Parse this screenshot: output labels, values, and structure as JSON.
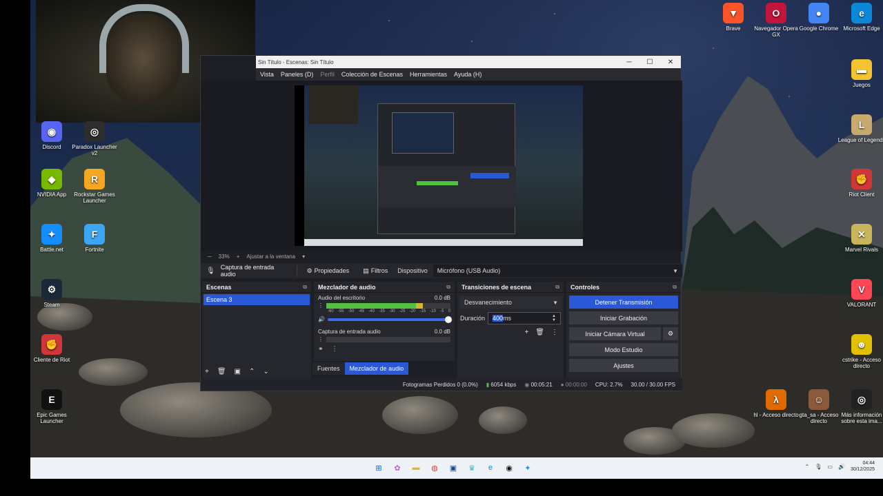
{
  "desktop_left": [
    {
      "id": "discord",
      "label": "Discord",
      "color": "#5865f2",
      "glyph": "◉",
      "icon": "discord-icon"
    },
    {
      "id": "paradox",
      "label": "Paradox Launcher v2",
      "color": "#2d2d2d",
      "glyph": "◎",
      "icon": "paradox-icon"
    },
    {
      "id": "nvidia",
      "label": "NVIDIA App",
      "color": "#76b900",
      "glyph": "◆",
      "icon": "nvidia-icon"
    },
    {
      "id": "rockstar",
      "label": "Rockstar Games Launcher",
      "color": "#f5a623",
      "glyph": "R",
      "icon": "rockstar-icon"
    },
    {
      "id": "battlenet",
      "label": "Battle.net",
      "color": "#148eff",
      "glyph": "✦",
      "icon": "battlenet-icon"
    },
    {
      "id": "fortnite",
      "label": "Fortnite",
      "color": "#3ca6f2",
      "glyph": "F",
      "icon": "fortnite-icon"
    },
    {
      "id": "steam",
      "label": "Steam",
      "color": "#1b2838",
      "glyph": "⚙",
      "icon": "steam-icon"
    },
    {
      "id": "riot-client-left",
      "label": "Cliente de Riot",
      "color": "#d13639",
      "glyph": "✊",
      "icon": "riot-icon"
    },
    {
      "id": "epic",
      "label": "Epic Games Launcher",
      "color": "#111111",
      "glyph": "E",
      "icon": "epic-games-icon"
    }
  ],
  "desktop_right": [
    {
      "id": "brave",
      "label": "Brave",
      "color": "#fb542b",
      "glyph": "▼",
      "icon": "brave-icon"
    },
    {
      "id": "opera",
      "label": "Navegador Opera GX",
      "color": "#c3143b",
      "glyph": "O",
      "icon": "opera-gx-icon"
    },
    {
      "id": "chrome",
      "label": "Google Chrome",
      "color": "#4285f4",
      "glyph": "●",
      "icon": "chrome-icon"
    },
    {
      "id": "edge",
      "label": "Microsoft Edge",
      "color": "#0c88d8",
      "glyph": "e",
      "icon": "edge-icon"
    },
    {
      "id": "juegos",
      "label": "Juegos",
      "color": "#f4c430",
      "glyph": "▬",
      "icon": "folder-icon"
    },
    {
      "id": "lol",
      "label": "League of Legends",
      "color": "#c8aa6e",
      "glyph": "L",
      "icon": "league-icon"
    },
    {
      "id": "riot",
      "label": "Riot Client",
      "color": "#d13639",
      "glyph": "✊",
      "icon": "riot-icon"
    },
    {
      "id": "marvel",
      "label": "Marvel Rivals",
      "color": "#c9b65a",
      "glyph": "✕",
      "icon": "marvel-rivals-icon"
    },
    {
      "id": "valorant",
      "label": "VALORANT",
      "color": "#ff4655",
      "glyph": "V",
      "icon": "valorant-icon"
    },
    {
      "id": "cstrike",
      "label": "cstrike - Acceso directo",
      "color": "#e0c000",
      "glyph": "☻",
      "icon": "cstrike-icon"
    },
    {
      "id": "hl",
      "label": "hl - Acceso directo",
      "color": "#e06a00",
      "glyph": "λ",
      "icon": "half-life-icon"
    },
    {
      "id": "gta",
      "label": "gta_sa - Acceso directo",
      "color": "#8a5a3a",
      "glyph": "☺",
      "icon": "gta-icon"
    },
    {
      "id": "info",
      "label": "Más información sobre esta ima...",
      "color": "#222222",
      "glyph": "◎",
      "icon": "info-icon"
    }
  ],
  "obs": {
    "title": "Sin Título - Escenas: Sin Título",
    "menu": [
      "Vista",
      "Paneles (D)",
      "Perfil",
      "Colección de Escenas",
      "Herramientas",
      "Ayuda (H)"
    ],
    "zoom": "33%",
    "fit_label": "Ajustar a la ventana",
    "source_name": "Captura de entrada audio",
    "properties": "Propiedades",
    "filters": "Filtros",
    "device_label": "Dispositivo",
    "device_value": "Micrófono (USB Audio)",
    "scenes_title": "Escenas",
    "scene_item": "Escena 3",
    "mixer_title": "Mezclador de audio",
    "mixer": [
      {
        "name": "Audio del escritorio",
        "db": "0.0 dB",
        "level": 0.78
      },
      {
        "name": "Captura de entrada audio",
        "db": "0.0 dB",
        "level": 0.0
      }
    ],
    "mixer_scale": [
      "-60",
      "-55",
      "-50",
      "-45",
      "-40",
      "-35",
      "-30",
      "-25",
      "-20",
      "-15",
      "-10",
      "-5",
      "0"
    ],
    "transitions_title": "Transiciones de escena",
    "transition": "Desvanecimiento",
    "duration_label": "Duración",
    "duration_value": "400",
    "duration_unit": " ms",
    "controls_title": "Controles",
    "controls": [
      "Detener Transmisión",
      "Iniciar Grabación",
      "Iniciar Cámara Virtual",
      "Modo Estudio",
      "Ajustes"
    ],
    "tab_sources": "Fuentes",
    "tab_mixer": "Mezclador de audio",
    "status_dropped": "Fotogramas Perdidos 0 (0.0%)",
    "status_kbps": "6054 kbps",
    "status_stream_time": "00:05:21",
    "status_rec_time": "00:00:00",
    "status_cpu": "CPU: 2.7%",
    "status_fps": "30.00 / 30.00 FPS"
  },
  "clock": {
    "time": "04:44",
    "date": "30/12/2025"
  }
}
